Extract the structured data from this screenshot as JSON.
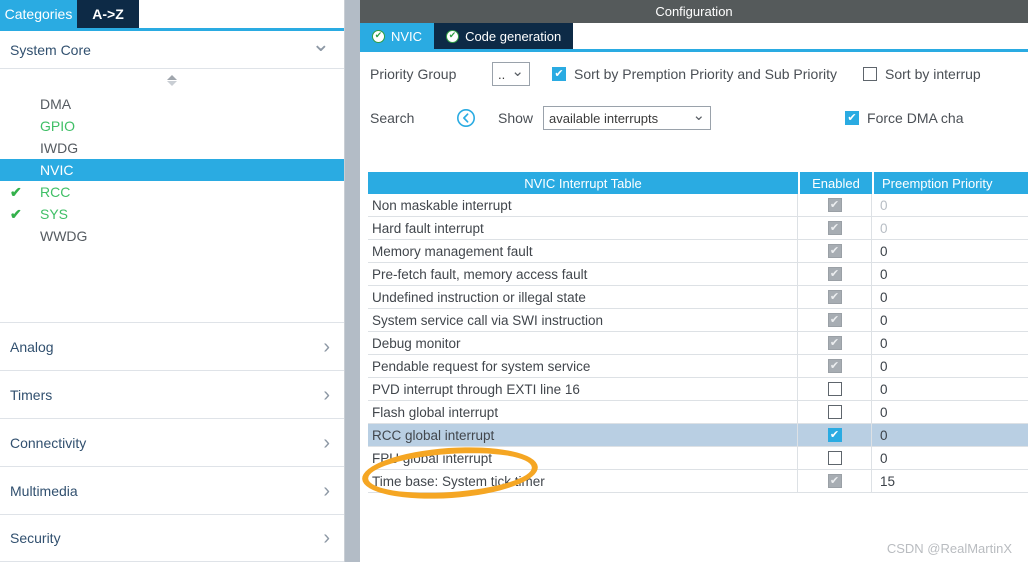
{
  "sidebar": {
    "tabs": [
      {
        "label": "Categories",
        "active": true
      },
      {
        "label": "A->Z",
        "active": false
      }
    ],
    "group": {
      "label": "System Core",
      "icon": "chevron-down-icon"
    },
    "peripherals": [
      {
        "label": "DMA",
        "configured": false,
        "color": "gray",
        "selected": false
      },
      {
        "label": "GPIO",
        "configured": false,
        "color": "green",
        "selected": false
      },
      {
        "label": "IWDG",
        "configured": false,
        "color": "gray",
        "selected": false
      },
      {
        "label": "NVIC",
        "configured": false,
        "color": "gray",
        "selected": true
      },
      {
        "label": "RCC",
        "configured": true,
        "color": "green",
        "selected": false
      },
      {
        "label": "SYS",
        "configured": true,
        "color": "green",
        "selected": false
      },
      {
        "label": "WWDG",
        "configured": false,
        "color": "gray",
        "selected": false
      }
    ],
    "categories": [
      {
        "label": "Analog"
      },
      {
        "label": "Timers"
      },
      {
        "label": "Connectivity"
      },
      {
        "label": "Multimedia"
      },
      {
        "label": "Security"
      }
    ]
  },
  "config": {
    "title": "Configuration",
    "tabs": [
      {
        "label": "NVIC",
        "active": true
      },
      {
        "label": "Code generation",
        "active": false
      }
    ],
    "options": {
      "priority_group_label": "Priority Group",
      "priority_group_value": "..",
      "sort_premption_label": "Sort by Premption Priority and Sub Priority",
      "sort_premption_checked": true,
      "sort_interrupt_label": "Sort by interrup",
      "sort_interrupt_checked": false,
      "search_label": "Search",
      "search_icon": "circle-left-chevron-icon",
      "show_label": "Show",
      "show_value": "available interrupts",
      "force_dma_label": "Force DMA cha",
      "force_dma_checked": true
    },
    "table": {
      "columns": [
        "NVIC Interrupt Table",
        "Enabled",
        "Preemption Priority"
      ],
      "rows": [
        {
          "name": "Non maskable interrupt",
          "enabled": "checked-gray",
          "priority": "0",
          "dim": true,
          "highlight": false
        },
        {
          "name": "Hard fault interrupt",
          "enabled": "checked-gray",
          "priority": "0",
          "dim": true,
          "highlight": false
        },
        {
          "name": "Memory management fault",
          "enabled": "checked-gray",
          "priority": "0",
          "dim": false,
          "highlight": false
        },
        {
          "name": "Pre-fetch fault, memory access fault",
          "enabled": "checked-gray",
          "priority": "0",
          "dim": false,
          "highlight": false
        },
        {
          "name": "Undefined instruction or illegal state",
          "enabled": "checked-gray",
          "priority": "0",
          "dim": false,
          "highlight": false
        },
        {
          "name": "System service call via SWI instruction",
          "enabled": "checked-gray",
          "priority": "0",
          "dim": false,
          "highlight": false
        },
        {
          "name": "Debug monitor",
          "enabled": "checked-gray",
          "priority": "0",
          "dim": false,
          "highlight": false
        },
        {
          "name": "Pendable request for system service",
          "enabled": "checked-gray",
          "priority": "0",
          "dim": false,
          "highlight": false
        },
        {
          "name": "PVD interrupt through EXTI line 16",
          "enabled": "unchecked",
          "priority": "0",
          "dim": false,
          "highlight": false
        },
        {
          "name": "Flash global interrupt",
          "enabled": "unchecked",
          "priority": "0",
          "dim": false,
          "highlight": false
        },
        {
          "name": "RCC global interrupt",
          "enabled": "checked-blue",
          "priority": "0",
          "dim": false,
          "highlight": true
        },
        {
          "name": "FPU global interrupt",
          "enabled": "unchecked",
          "priority": "0",
          "dim": false,
          "highlight": false
        },
        {
          "name": "Time base: System tick timer",
          "enabled": "checked-gray",
          "priority": "15",
          "dim": false,
          "highlight": false
        }
      ]
    }
  },
  "annotation": {
    "shape": "ellipse",
    "color": "#f5a623",
    "target": "RCC global interrupt"
  },
  "watermark": "CSDN @RealMartinX"
}
